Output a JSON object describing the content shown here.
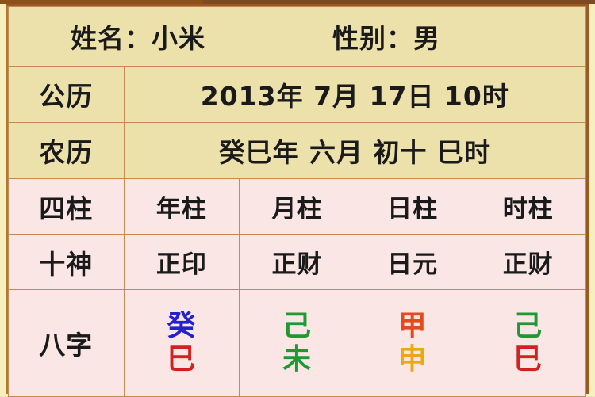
{
  "header": {
    "name_label": "姓名：小米",
    "gender_label": "性别：男"
  },
  "rows": {
    "solar": {
      "label": "公历",
      "value": "2013年 7月 17日 10时"
    },
    "lunar": {
      "label": "农历",
      "value": "癸巳年 六月 初十 巳时"
    },
    "pillars": {
      "label": "四柱",
      "values": [
        "年柱",
        "月柱",
        "日柱",
        "时柱"
      ]
    },
    "ten_gods": {
      "label": "十神",
      "values": [
        "正印",
        "正财",
        "日元",
        "正财"
      ]
    },
    "bazi": {
      "label": "八字",
      "columns": [
        {
          "stem": "癸",
          "stem_color": "#2222cc",
          "branch": "巳",
          "branch_color": "#d42020"
        },
        {
          "stem": "己",
          "stem_color": "#1f9933",
          "branch": "未",
          "branch_color": "#1f9933"
        },
        {
          "stem": "甲",
          "stem_color": "#e34a1c",
          "branch": "申",
          "branch_color": "#e8a818"
        },
        {
          "stem": "己",
          "stem_color": "#1f9933",
          "branch": "巳",
          "branch_color": "#d42020"
        }
      ]
    }
  },
  "colors": {
    "paper_beige": "#ece0ab",
    "paper_pink": "#fbe6e6",
    "border": "#c58a52",
    "border_strong": "#a8612a",
    "page_bg": "#f7efbe",
    "top_strip": "#7d4a22"
  }
}
